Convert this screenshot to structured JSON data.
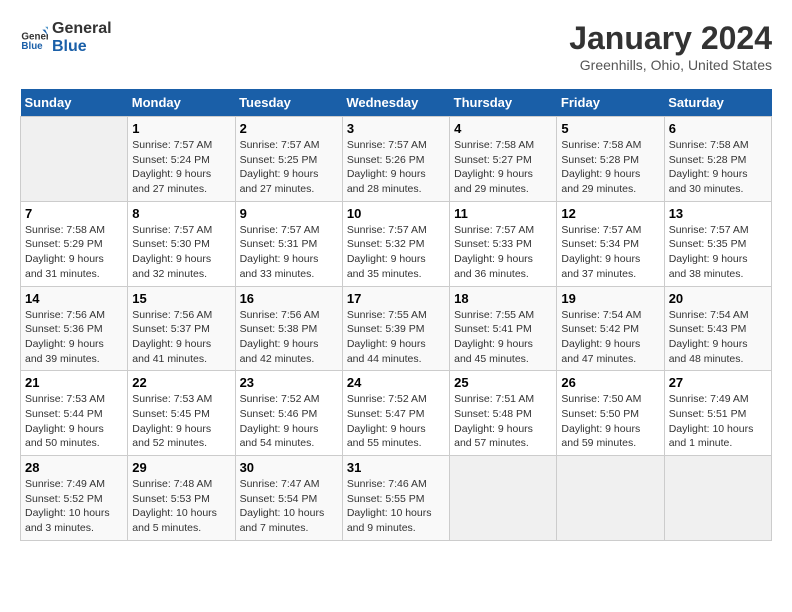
{
  "header": {
    "logo_line1": "General",
    "logo_line2": "Blue",
    "month": "January 2024",
    "location": "Greenhills, Ohio, United States"
  },
  "days_of_week": [
    "Sunday",
    "Monday",
    "Tuesday",
    "Wednesday",
    "Thursday",
    "Friday",
    "Saturday"
  ],
  "weeks": [
    [
      {
        "day": "",
        "empty": true
      },
      {
        "day": "1",
        "sunrise": "7:57 AM",
        "sunset": "5:24 PM",
        "daylight": "9 hours and 27 minutes."
      },
      {
        "day": "2",
        "sunrise": "7:57 AM",
        "sunset": "5:25 PM",
        "daylight": "9 hours and 27 minutes."
      },
      {
        "day": "3",
        "sunrise": "7:57 AM",
        "sunset": "5:26 PM",
        "daylight": "9 hours and 28 minutes."
      },
      {
        "day": "4",
        "sunrise": "7:58 AM",
        "sunset": "5:27 PM",
        "daylight": "9 hours and 29 minutes."
      },
      {
        "day": "5",
        "sunrise": "7:58 AM",
        "sunset": "5:28 PM",
        "daylight": "9 hours and 29 minutes."
      },
      {
        "day": "6",
        "sunrise": "7:58 AM",
        "sunset": "5:28 PM",
        "daylight": "9 hours and 30 minutes."
      }
    ],
    [
      {
        "day": "7",
        "sunrise": "7:58 AM",
        "sunset": "5:29 PM",
        "daylight": "9 hours and 31 minutes."
      },
      {
        "day": "8",
        "sunrise": "7:57 AM",
        "sunset": "5:30 PM",
        "daylight": "9 hours and 32 minutes."
      },
      {
        "day": "9",
        "sunrise": "7:57 AM",
        "sunset": "5:31 PM",
        "daylight": "9 hours and 33 minutes."
      },
      {
        "day": "10",
        "sunrise": "7:57 AM",
        "sunset": "5:32 PM",
        "daylight": "9 hours and 35 minutes."
      },
      {
        "day": "11",
        "sunrise": "7:57 AM",
        "sunset": "5:33 PM",
        "daylight": "9 hours and 36 minutes."
      },
      {
        "day": "12",
        "sunrise": "7:57 AM",
        "sunset": "5:34 PM",
        "daylight": "9 hours and 37 minutes."
      },
      {
        "day": "13",
        "sunrise": "7:57 AM",
        "sunset": "5:35 PM",
        "daylight": "9 hours and 38 minutes."
      }
    ],
    [
      {
        "day": "14",
        "sunrise": "7:56 AM",
        "sunset": "5:36 PM",
        "daylight": "9 hours and 39 minutes."
      },
      {
        "day": "15",
        "sunrise": "7:56 AM",
        "sunset": "5:37 PM",
        "daylight": "9 hours and 41 minutes."
      },
      {
        "day": "16",
        "sunrise": "7:56 AM",
        "sunset": "5:38 PM",
        "daylight": "9 hours and 42 minutes."
      },
      {
        "day": "17",
        "sunrise": "7:55 AM",
        "sunset": "5:39 PM",
        "daylight": "9 hours and 44 minutes."
      },
      {
        "day": "18",
        "sunrise": "7:55 AM",
        "sunset": "5:41 PM",
        "daylight": "9 hours and 45 minutes."
      },
      {
        "day": "19",
        "sunrise": "7:54 AM",
        "sunset": "5:42 PM",
        "daylight": "9 hours and 47 minutes."
      },
      {
        "day": "20",
        "sunrise": "7:54 AM",
        "sunset": "5:43 PM",
        "daylight": "9 hours and 48 minutes."
      }
    ],
    [
      {
        "day": "21",
        "sunrise": "7:53 AM",
        "sunset": "5:44 PM",
        "daylight": "9 hours and 50 minutes."
      },
      {
        "day": "22",
        "sunrise": "7:53 AM",
        "sunset": "5:45 PM",
        "daylight": "9 hours and 52 minutes."
      },
      {
        "day": "23",
        "sunrise": "7:52 AM",
        "sunset": "5:46 PM",
        "daylight": "9 hours and 54 minutes."
      },
      {
        "day": "24",
        "sunrise": "7:52 AM",
        "sunset": "5:47 PM",
        "daylight": "9 hours and 55 minutes."
      },
      {
        "day": "25",
        "sunrise": "7:51 AM",
        "sunset": "5:48 PM",
        "daylight": "9 hours and 57 minutes."
      },
      {
        "day": "26",
        "sunrise": "7:50 AM",
        "sunset": "5:50 PM",
        "daylight": "9 hours and 59 minutes."
      },
      {
        "day": "27",
        "sunrise": "7:49 AM",
        "sunset": "5:51 PM",
        "daylight": "10 hours and 1 minute."
      }
    ],
    [
      {
        "day": "28",
        "sunrise": "7:49 AM",
        "sunset": "5:52 PM",
        "daylight": "10 hours and 3 minutes."
      },
      {
        "day": "29",
        "sunrise": "7:48 AM",
        "sunset": "5:53 PM",
        "daylight": "10 hours and 5 minutes."
      },
      {
        "day": "30",
        "sunrise": "7:47 AM",
        "sunset": "5:54 PM",
        "daylight": "10 hours and 7 minutes."
      },
      {
        "day": "31",
        "sunrise": "7:46 AM",
        "sunset": "5:55 PM",
        "daylight": "10 hours and 9 minutes."
      },
      {
        "day": "",
        "empty": true
      },
      {
        "day": "",
        "empty": true
      },
      {
        "day": "",
        "empty": true
      }
    ]
  ]
}
